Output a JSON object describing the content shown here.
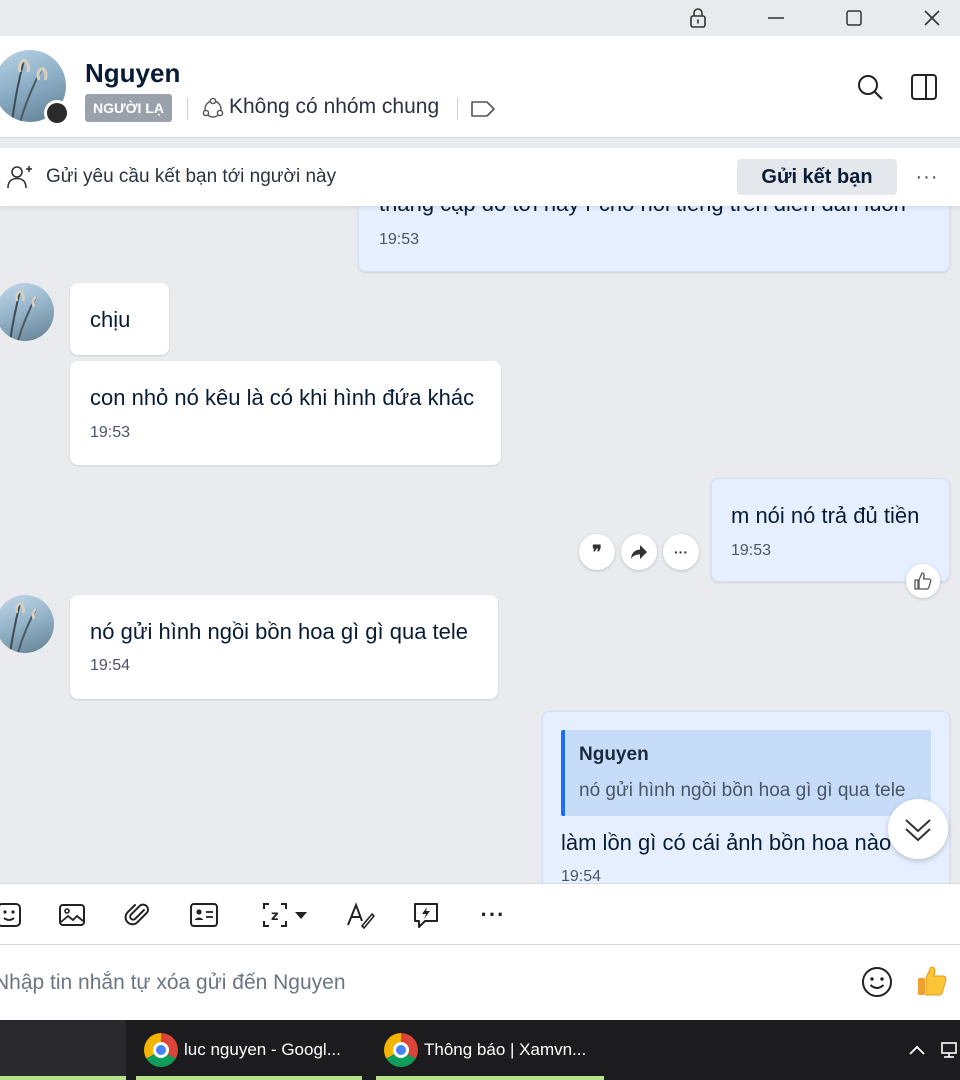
{
  "window": {
    "lock_icon": "lock-icon",
    "minimize_icon": "minimize-icon",
    "maximize_icon": "maximize-icon",
    "close_icon": "close-icon"
  },
  "header": {
    "name": "Nguyen",
    "badge": "NGƯỜI LẠ",
    "groups_text": "Không có nhóm chung"
  },
  "friend_request": {
    "text": "Gửi yêu cầu kết bạn tới người này",
    "button": "Gửi kết bạn",
    "more": "···"
  },
  "messages": [
    {
      "id": "m0",
      "direction": "out",
      "text": "thằng cặp đó tới nay r cho nổi tiếng trên diễn đàn luôn",
      "time": "19:53"
    },
    {
      "id": "m1",
      "direction": "in",
      "text": "chịu"
    },
    {
      "id": "m2",
      "direction": "in",
      "text": "con nhỏ nó kêu là có khi hình đứa khác",
      "time": "19:53"
    },
    {
      "id": "m3",
      "direction": "out",
      "text": "m nói nó trả đủ tiền",
      "time": "19:53"
    },
    {
      "id": "m4",
      "direction": "in",
      "text": "nó gửi hình ngồi bồn hoa gì gì qua tele",
      "time": "19:54"
    },
    {
      "id": "m5",
      "direction": "out",
      "quote_name": "Nguyen",
      "quote_text": "nó gửi hình ngồi bồn hoa gì gì qua tele",
      "text": "làm lồn gì có cái ảnh bồn hoa nào",
      "time": "19:54"
    }
  ],
  "message_actions": {
    "quote": "99",
    "forward": "forward-icon",
    "more": "···"
  },
  "composer": {
    "placeholder": "Nhập tin nhắn tự xóa gửi đến Nguyen",
    "more": "···"
  },
  "taskbar": {
    "items": [
      {
        "label": "luc nguyen - Googl..."
      },
      {
        "label": "Thông báo | Xamvn..."
      }
    ]
  },
  "colors": {
    "accent": "#1b6ef0",
    "outgoing_bubble": "#e5efff",
    "incoming_bubble": "#ffffff",
    "chat_background": "#e9ebef",
    "taskbar_underline": "#b5e28a"
  }
}
